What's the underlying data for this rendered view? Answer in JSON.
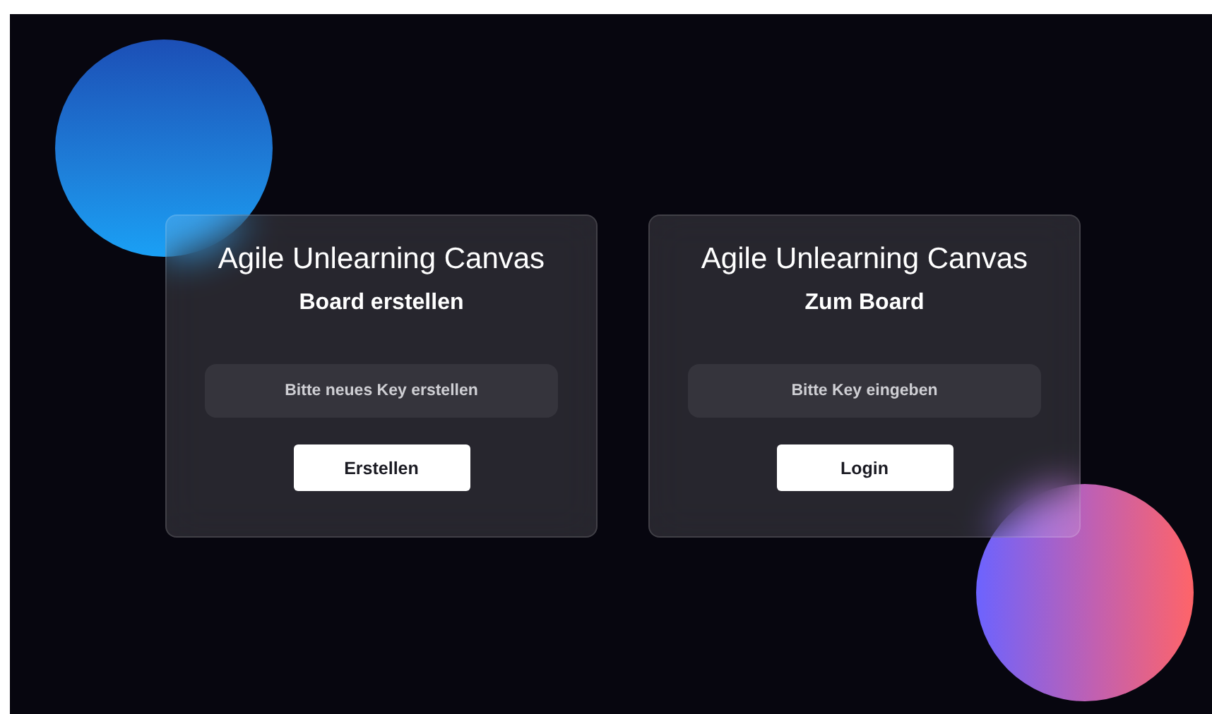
{
  "cards": [
    {
      "title": "Agile Unlearning Canvas",
      "subtitle": "Board erstellen",
      "field": {
        "placeholder": "Bitte neues Key erstellen"
      },
      "button": "Erstellen"
    },
    {
      "title": "Agile Unlearning Canvas",
      "subtitle": "Zum Board",
      "field": {
        "placeholder": "Bitte Key eingeben"
      },
      "button": "Login"
    }
  ]
}
